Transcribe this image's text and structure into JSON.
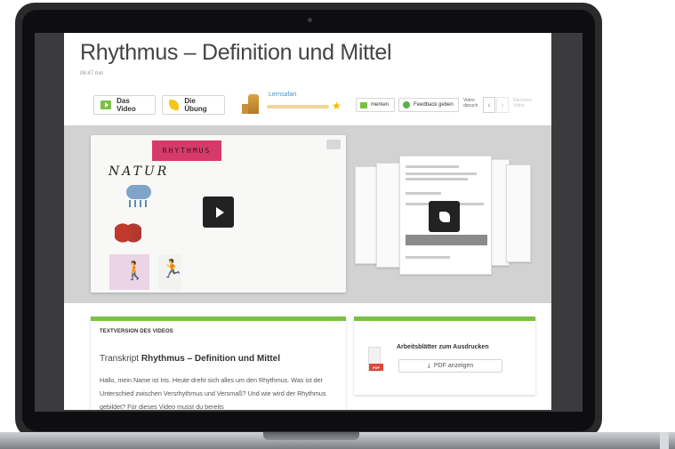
{
  "lesson": {
    "title": "Rhythmus – Definition und Mittel",
    "duration": "06:47 min"
  },
  "toolbar": {
    "video_tab": "Das Video",
    "exercise_tab": "Die Übung",
    "lernsafari_label": "Lernsafari",
    "merken_label": "merken",
    "feedback_label": "Feedback geben",
    "video_danach_label": "Video danach",
    "next_video_label": "Nächstes Video"
  },
  "video": {
    "board_sign": "RHYTHMUS",
    "board_text": "NATUR"
  },
  "transcript": {
    "section_heading": "TEXTVERSION DES VIDEOS",
    "prefix": "Transkript",
    "title": "Rhythmus – Definition und Mittel",
    "body": "Hallo, mein Name ist Iris. Heute dreht sich alles um den Rhythmus. Was ist der Unterschied zwischen Versrhythmus und Versmaß? Und wie wird der Rhythmus gebildet? Für dieses Video musst du bereits"
  },
  "worksheets": {
    "title": "Arbeitsblätter zum Ausdrucken",
    "button_label": "PDF anzeigen",
    "file_badge": "PDF"
  },
  "icons": {
    "video": "video-play-icon",
    "exercise": "pencil-icon",
    "merken": "bookmark-icon",
    "feedback": "chat-icon",
    "star": "star-icon",
    "pdf": "pdf-file-icon",
    "download": "download-icon"
  },
  "colors": {
    "accent_green": "#7ac142",
    "pdf_red": "#e0463a",
    "star_yellow": "#f5b800",
    "pencil_yellow": "#f5c518"
  }
}
